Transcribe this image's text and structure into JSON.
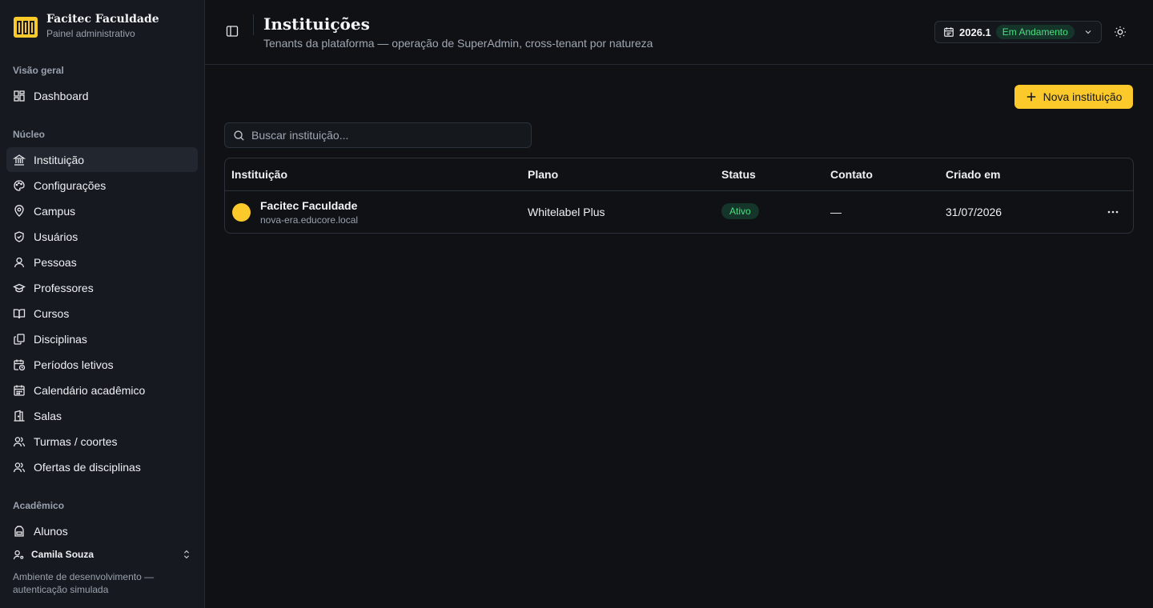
{
  "brand": {
    "title": "Facitec Faculdade",
    "subtitle": "Painel administrativo"
  },
  "sidebar": {
    "sections": [
      {
        "label": "Visão geral"
      },
      {
        "label": "Núcleo"
      },
      {
        "label": "Acadêmico"
      }
    ],
    "items": [
      {
        "label": "Dashboard",
        "icon": "grid-icon"
      },
      {
        "label": "Instituição",
        "icon": "bank-icon",
        "active": true
      },
      {
        "label": "Configurações",
        "icon": "palette-icon"
      },
      {
        "label": "Campus",
        "icon": "map-pin-icon"
      },
      {
        "label": "Usuários",
        "icon": "shield-icon"
      },
      {
        "label": "Pessoas",
        "icon": "user-icon"
      },
      {
        "label": "Professores",
        "icon": "graduation-cap-icon"
      },
      {
        "label": "Cursos",
        "icon": "book-open-icon"
      },
      {
        "label": "Disciplinas",
        "icon": "copy-icon"
      },
      {
        "label": "Períodos letivos",
        "icon": "calendar-clock-icon"
      },
      {
        "label": "Calendário acadêmico",
        "icon": "calendar-icon"
      },
      {
        "label": "Salas",
        "icon": "door-icon"
      },
      {
        "label": "Turmas / coortes",
        "icon": "users-icon"
      },
      {
        "label": "Ofertas de disciplinas",
        "icon": "users-icon"
      },
      {
        "label": "Alunos",
        "icon": "backpack-icon"
      }
    ],
    "user": {
      "name": "Camila Souza"
    },
    "env_note": "Ambiente de desenvolvimento — autenticação simulada"
  },
  "header": {
    "title": "Instituições",
    "subtitle": "Tenants da plataforma — operação de SuperAdmin, cross-tenant por natureza",
    "period": {
      "year": "2026.1",
      "status": "Em Andamento"
    }
  },
  "main": {
    "new_button": "Nova instituição",
    "search": {
      "placeholder": "Buscar instituição...",
      "value": ""
    },
    "table": {
      "columns": [
        "Instituição",
        "Plano",
        "Status",
        "Contato",
        "Criado em"
      ],
      "rows": [
        {
          "name": "Facitec Faculdade",
          "domain": "nova-era.educore.local",
          "plan": "Whitelabel Plus",
          "status": "Ativo",
          "contact": "—",
          "created": "31/07/2026"
        }
      ]
    }
  },
  "colors": {
    "accent": "#fcc92b",
    "success": "#4ade80",
    "background": "#0f1115",
    "sidebar": "#161a20"
  }
}
